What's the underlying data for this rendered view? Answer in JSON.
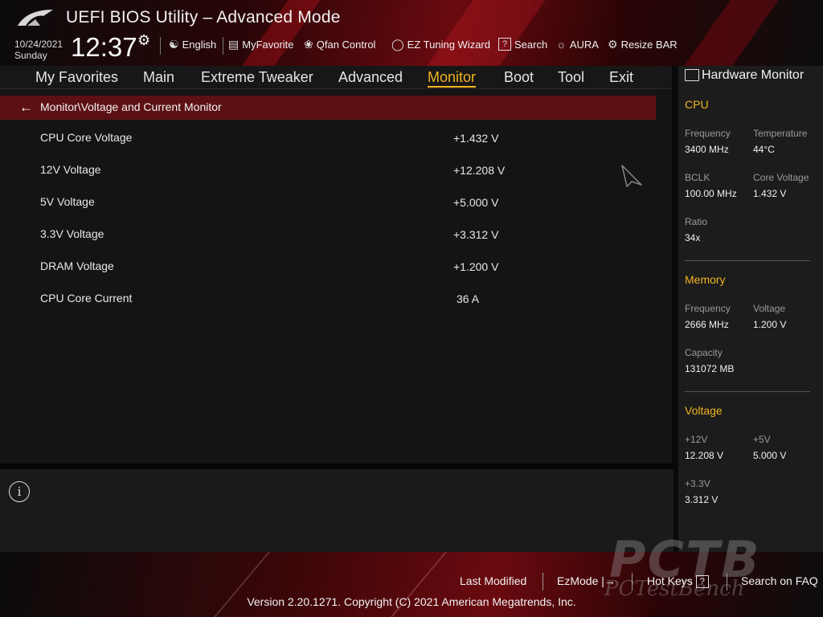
{
  "header": {
    "title": "UEFI BIOS Utility – Advanced Mode",
    "date": "10/24/2021",
    "day": "Sunday",
    "time": "12:37",
    "tools": [
      {
        "label": "English",
        "icon": "globe-icon"
      },
      {
        "label": "MyFavorite",
        "icon": "favorite-list-icon"
      },
      {
        "label": "Qfan Control",
        "icon": "fan-icon"
      },
      {
        "label": "EZ Tuning Wizard",
        "icon": "lightbulb-icon"
      },
      {
        "label": "Search",
        "icon": "question-box-icon"
      },
      {
        "label": "AURA",
        "icon": "aura-icon"
      },
      {
        "label": "Resize BAR",
        "icon": "resize-bar-icon"
      }
    ]
  },
  "menu": {
    "items": [
      "My Favorites",
      "Main",
      "Extreme Tweaker",
      "Advanced",
      "Monitor",
      "Boot",
      "Tool",
      "Exit"
    ],
    "active": "Monitor"
  },
  "breadcrumb": "Monitor\\Voltage and Current Monitor",
  "rows": [
    {
      "label": "CPU Core Voltage",
      "value": "+1.432 V"
    },
    {
      "label": "12V Voltage",
      "value": "+12.208 V"
    },
    {
      "label": "5V Voltage",
      "value": "+5.000 V"
    },
    {
      "label": "3.3V Voltage",
      "value": "+3.312 V"
    },
    {
      "label": "DRAM Voltage",
      "value": "+1.200 V"
    },
    {
      "label": "CPU Core Current",
      "value": "36 A"
    }
  ],
  "hardware_monitor": {
    "title": "Hardware Monitor",
    "cpu": {
      "title": "CPU",
      "frequency_label": "Frequency",
      "frequency": "3400 MHz",
      "temperature_label": "Temperature",
      "temperature": "44°C",
      "bclk_label": "BCLK",
      "bclk": "100.00 MHz",
      "core_voltage_label": "Core Voltage",
      "core_voltage": "1.432 V",
      "ratio_label": "Ratio",
      "ratio": "34x"
    },
    "memory": {
      "title": "Memory",
      "frequency_label": "Frequency",
      "frequency": "2666 MHz",
      "voltage_label": "Voltage",
      "voltage": "1.200 V",
      "capacity_label": "Capacity",
      "capacity": "131072 MB"
    },
    "voltage": {
      "title": "Voltage",
      "v12_label": "+12V",
      "v12": "12.208 V",
      "v5_label": "+5V",
      "v5": "5.000 V",
      "v33_label": "+3.3V",
      "v33": "3.312 V"
    }
  },
  "footer": {
    "last_modified": "Last Modified",
    "ezmode": "EzMode",
    "hot_keys": "Hot Keys",
    "hot_keys_key": "?",
    "search_faq": "Search on FAQ",
    "version": "Version 2.20.1271. Copyright (C) 2021 American Megatrends, Inc."
  },
  "watermark": {
    "big": "PCTB",
    "small": "PCTestBench"
  },
  "colors": {
    "accent": "#f0b41e",
    "breadcrumb_bg": "#5c1014",
    "panel_bg": "#1c1c1c",
    "bg": "#141414"
  }
}
